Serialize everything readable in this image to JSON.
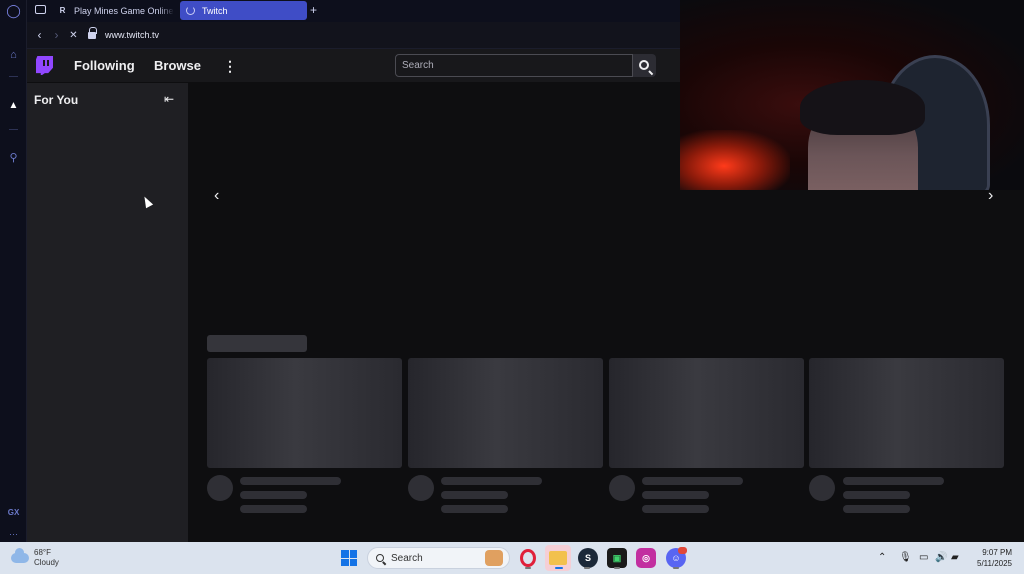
{
  "browser": {
    "tabs": [
      {
        "title": "Play Mines Game Online",
        "favicon": "R",
        "active": false
      },
      {
        "title": "Twitch",
        "favicon": "loading-spinner",
        "active": true
      }
    ],
    "new_tab_label": "+",
    "url": "www.twitch.tv",
    "icons": {
      "back": "‹",
      "forward": "›",
      "reload": "✕"
    }
  },
  "opera_sidebar": {
    "gx_label": "GX",
    "more": "···"
  },
  "twitch": {
    "nav": {
      "following": "Following",
      "browse": "Browse",
      "more": "⋮",
      "search_placeholder": "Search"
    },
    "sidebar": {
      "title": "For You",
      "collapse_icon": "⇤"
    },
    "carousel": {
      "prev": "‹",
      "next": "›"
    },
    "skeleton_cards": 4
  },
  "taskbar": {
    "weather": {
      "temp": "68°F",
      "condition": "Cloudy"
    },
    "search_placeholder": "Search",
    "clock": {
      "time": "9:07 PM",
      "date": "5/11/2025"
    },
    "discord_badge": "",
    "accent": "#1473e6"
  },
  "colors": {
    "twitch_purple": "#9147ff",
    "opera_tab_active": "#3f4dc6"
  }
}
